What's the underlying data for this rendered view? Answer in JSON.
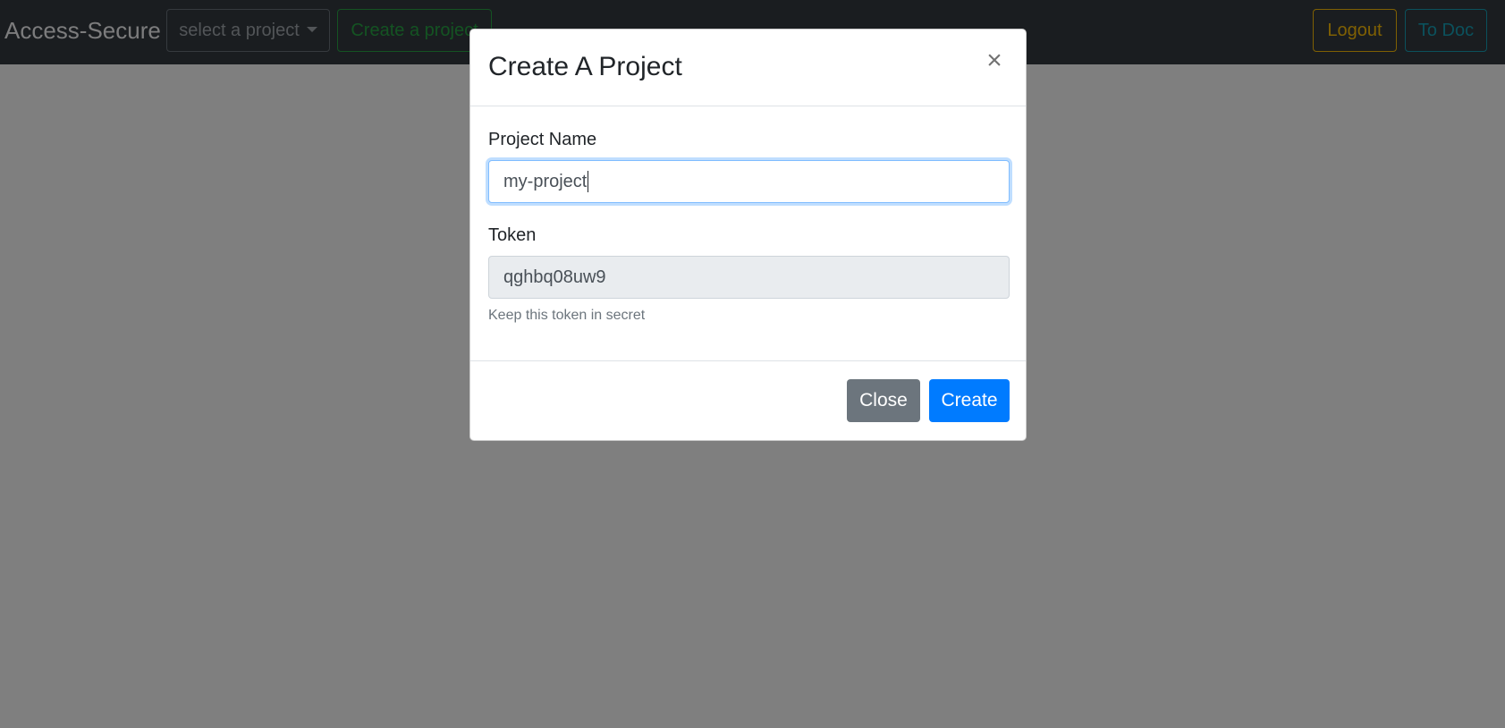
{
  "navbar": {
    "brand": "Access-Secure",
    "project_select_label": "select a project",
    "create_project_label": "Create a project",
    "logout_label": "Logout",
    "to_doc_label": "To Doc"
  },
  "modal": {
    "title": "Create A Project",
    "close_symbol": "×",
    "project_name_label": "Project Name",
    "project_name_value": "my-project",
    "token_label": "Token",
    "token_value": "qghbq08uw9",
    "token_help": "Keep this token in secret",
    "close_button_label": "Close",
    "create_button_label": "Create"
  },
  "colors": {
    "navbar_bg": "#343a40",
    "primary": "#007bff",
    "secondary": "#6c757d",
    "success": "#28a745",
    "warning": "#ffc107",
    "info": "#17a2b8"
  }
}
